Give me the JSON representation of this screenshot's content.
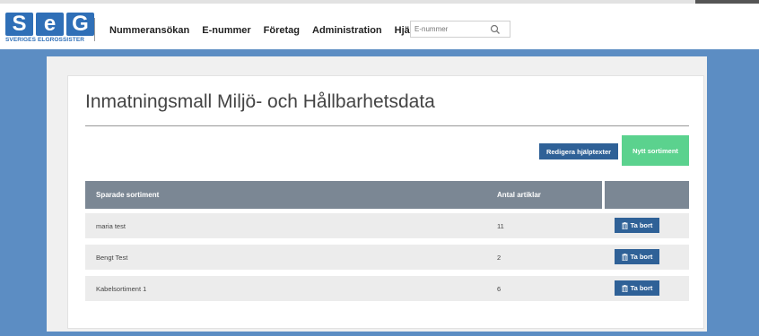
{
  "brand": {
    "logo_letters": [
      "S",
      "e",
      "G"
    ],
    "logo_subtitle": "SVERIGES ELGROSSISTER",
    "color": "#2f6fb7"
  },
  "nav": {
    "items": [
      "Nummeransökan",
      "E-nummer",
      "Företag",
      "Administration",
      "Hjälp"
    ]
  },
  "search": {
    "placeholder": "E-nummer",
    "icon": "search-icon"
  },
  "page": {
    "title": "Inmatningsmall Miljö- och Hållbarhetsdata"
  },
  "actions": {
    "edit_help_label": "Redigera hjälptexter",
    "new_assortment_label": "Nytt sortiment"
  },
  "table": {
    "columns": [
      "Sparade sortiment",
      "Antal artiklar",
      ""
    ],
    "rows": [
      {
        "name": "maria test",
        "count": "11",
        "action": "Ta bort"
      },
      {
        "name": "Bengt Test",
        "count": "2",
        "action": "Ta bort"
      },
      {
        "name": "Kabelsortiment 1",
        "count": "6",
        "action": "Ta bort"
      }
    ]
  },
  "colors": {
    "accent_blue": "#2f6197",
    "accent_green": "#5bd28e",
    "background_blue": "#5c8dc3",
    "table_header": "#7b8794"
  }
}
